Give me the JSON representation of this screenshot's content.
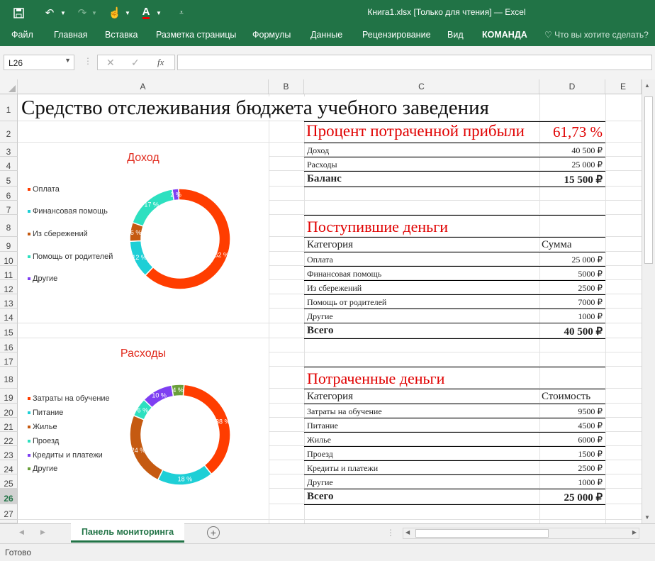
{
  "app": {
    "window_title": "Книга1.xlsx [Только для чтения] — Excel",
    "status": "Готово"
  },
  "ribbon": {
    "tabs": [
      "Файл",
      "Главная",
      "Вставка",
      "Разметка страницы",
      "Формулы",
      "Данные",
      "Рецензирование",
      "Вид",
      "КОМАНДА"
    ],
    "tell_me": "Что вы хотите сделать?"
  },
  "formula_bar": {
    "name_box": "L26",
    "fx": "fx",
    "formula": ""
  },
  "columns": [
    "A",
    "B",
    "C",
    "D",
    "E"
  ],
  "rows": [
    "1",
    "2",
    "3",
    "4",
    "5",
    "6",
    "7",
    "8",
    "9",
    "10",
    "11",
    "12",
    "13",
    "14",
    "15",
    "16",
    "17",
    "18",
    "19",
    "20",
    "21",
    "22",
    "23",
    "24",
    "25",
    "26",
    "27"
  ],
  "sheet": {
    "title": "Средство отслеживания бюджета учебного заведения",
    "percent_label": "Процент потраченной прибыли",
    "percent_value": "61,73 %",
    "summary": [
      {
        "label": "Доход",
        "value": "40 500 ₽"
      },
      {
        "label": "Расходы",
        "value": "25 000 ₽"
      }
    ],
    "balance_label": "Баланс",
    "balance_value": "15 500 ₽",
    "income_header": "Поступившие деньги",
    "income_col1": "Категория",
    "income_col2": "Сумма",
    "income_rows": [
      {
        "label": "Оплата",
        "value": "25 000 ₽"
      },
      {
        "label": "Финансовая помощь",
        "value": "5000 ₽"
      },
      {
        "label": "Из сбережений",
        "value": "2500 ₽"
      },
      {
        "label": "Помощь от родителей",
        "value": "7000 ₽"
      },
      {
        "label": "Другие",
        "value": "1000 ₽"
      }
    ],
    "income_total_label": "Всего",
    "income_total": "40 500 ₽",
    "expense_header": "Потраченные деньги",
    "expense_col1": "Категория",
    "expense_col2": "Стоимость",
    "expense_rows": [
      {
        "label": "Затраты на обучение",
        "value": "9500 ₽"
      },
      {
        "label": "Питание",
        "value": "4500 ₽"
      },
      {
        "label": "Жилье",
        "value": "6000 ₽"
      },
      {
        "label": "Проезд",
        "value": "1500 ₽"
      },
      {
        "label": "Кредиты и платежи",
        "value": "2500 ₽"
      },
      {
        "label": "Другие",
        "value": "1000 ₽"
      }
    ],
    "expense_total_label": "Всего",
    "expense_total": "25 000 ₽"
  },
  "chart_data": [
    {
      "type": "pie",
      "title": "Доход",
      "categories": [
        "Оплата",
        "Финансовая помощь",
        "Из сбережений",
        "Помощь от родителей",
        "Другие"
      ],
      "values": [
        62,
        12,
        6,
        17,
        2
      ],
      "labels": [
        "62 %",
        "12 %",
        "6 %",
        "17 %",
        "2 %"
      ],
      "colors": [
        "#ff3d00",
        "#1ecfd6",
        "#c55a11",
        "#2de0c0",
        "#7e3ff2"
      ]
    },
    {
      "type": "pie",
      "title": "Расходы",
      "categories": [
        "Затраты на обучение",
        "Питание",
        "Жилье",
        "Проезд",
        "Кредиты и платежи",
        "Другие"
      ],
      "values": [
        38,
        18,
        24,
        6,
        10,
        4
      ],
      "labels": [
        "38 %",
        "18 %",
        "24 %",
        "6 %",
        "10 %",
        "4 %"
      ],
      "colors": [
        "#ff3d00",
        "#1ecfd6",
        "#c55a11",
        "#2de0c0",
        "#7e3ff2",
        "#6a9f3a"
      ]
    }
  ],
  "sheet_tabs": [
    "Панель мониторинга"
  ]
}
